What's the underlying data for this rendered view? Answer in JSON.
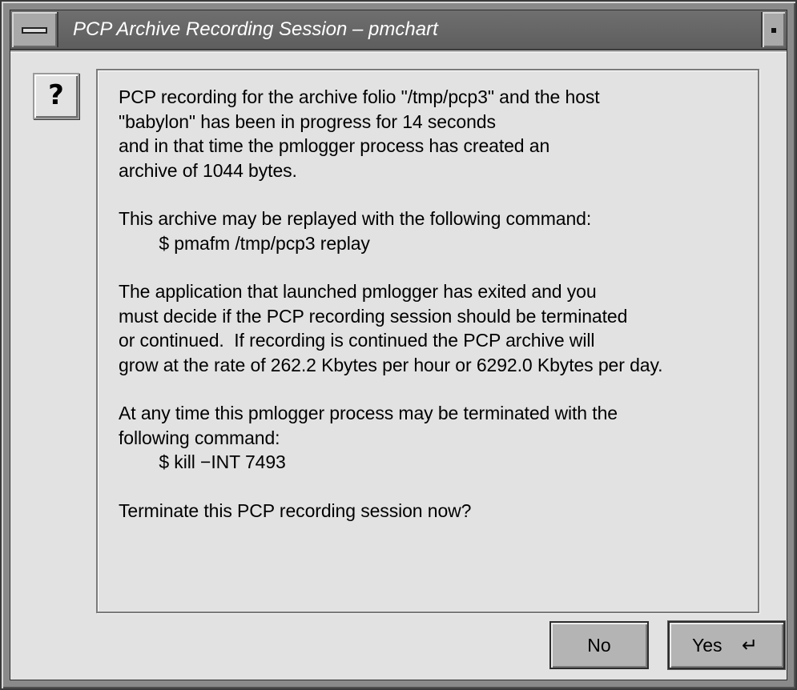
{
  "window": {
    "title": "PCP Archive Recording Session – pmchart"
  },
  "dialog": {
    "icon_symbol": "?",
    "icon_name": "question-icon",
    "paragraphs": [
      [
        "PCP recording for the archive folio \"/tmp/pcp3\" and the host",
        "\"babylon\" has been in progress for 14 seconds",
        "and in that time the pmlogger process has created an",
        "archive of 1044 bytes."
      ],
      [
        "This archive may be replayed with the following command:",
        "        $ pmafm /tmp/pcp3 replay"
      ],
      [
        "The application that launched pmlogger has exited and you",
        "must decide if the PCP recording session should be terminated",
        "or continued.  If recording is continued the PCP archive will",
        "grow at the rate of 262.2 Kbytes per hour or 6292.0 Kbytes per day."
      ],
      [
        "At any time this pmlogger process may be terminated with the",
        "following command:",
        "        $ kill −INT 7493"
      ],
      [
        "Terminate this PCP recording session now?"
      ]
    ]
  },
  "buttons": {
    "no_label": "No",
    "yes_label": "Yes",
    "yes_icon": "↵",
    "yes_icon_name": "enter-key-icon"
  },
  "colors": {
    "titlebar": "#666666",
    "client_bg": "#e2e2e2",
    "button_bg": "#b4b4b4"
  }
}
